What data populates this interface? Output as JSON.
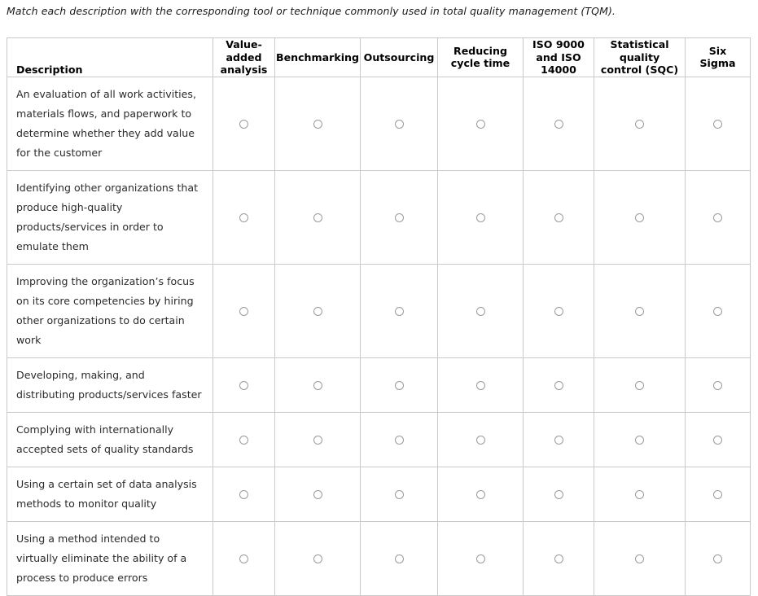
{
  "instruction": "Match each description with the corresponding tool or technique commonly used in total quality management (TQM).",
  "table": {
    "headers": {
      "description": "Description",
      "columns": [
        {
          "id": "value-added-analysis",
          "lines": [
            "Value-",
            "added",
            "analysis"
          ]
        },
        {
          "id": "benchmarking",
          "lines": [
            "Benchmarking"
          ]
        },
        {
          "id": "outsourcing",
          "lines": [
            "Outsourcing"
          ]
        },
        {
          "id": "reducing-cycle-time",
          "lines": [
            "Reducing",
            "cycle time"
          ]
        },
        {
          "id": "iso-9000-and-iso-14000",
          "lines": [
            "ISO 9000",
            "and ISO",
            "14000"
          ]
        },
        {
          "id": "statistical-quality-control-sqc",
          "lines": [
            "Statistical",
            "quality",
            "control (SQC)"
          ]
        },
        {
          "id": "six-sigma",
          "lines": [
            "Six",
            "Sigma"
          ]
        }
      ]
    },
    "rows": [
      {
        "id": "row-value-added-analysis",
        "description_lines": [
          "An evaluation of all work activities,",
          "materials flows, and paperwork to",
          "determine whether they add value",
          "for the customer"
        ],
        "selected": null
      },
      {
        "id": "row-benchmarking",
        "description_lines": [
          "Identifying other organizations that",
          "produce high-quality",
          "products/services in order to",
          "emulate them"
        ],
        "selected": null
      },
      {
        "id": "row-outsourcing",
        "description_lines": [
          "Improving the organization’s focus",
          "on its core competencies by hiring",
          "other organizations to do certain",
          "work"
        ],
        "selected": null
      },
      {
        "id": "row-reducing-cycle-time",
        "description_lines": [
          "Developing, making, and",
          "distributing products/services faster"
        ],
        "selected": null
      },
      {
        "id": "row-iso-standards",
        "description_lines": [
          "Complying with internationally",
          "accepted sets of quality standards"
        ],
        "selected": null
      },
      {
        "id": "row-statistical-quality-control",
        "description_lines": [
          "Using a certain set of data analysis",
          "methods to monitor quality"
        ],
        "selected": null
      },
      {
        "id": "row-six-sigma",
        "description_lines": [
          "Using a method intended to",
          "virtually eliminate the ability of a",
          "process to produce errors"
        ],
        "selected": null
      }
    ]
  },
  "colors": {
    "border": "#c9c9c9",
    "header_rule": "#9a9a9a",
    "text": "#2b2b2b",
    "radio_border": "#9b9b9b",
    "background": "#ffffff"
  }
}
